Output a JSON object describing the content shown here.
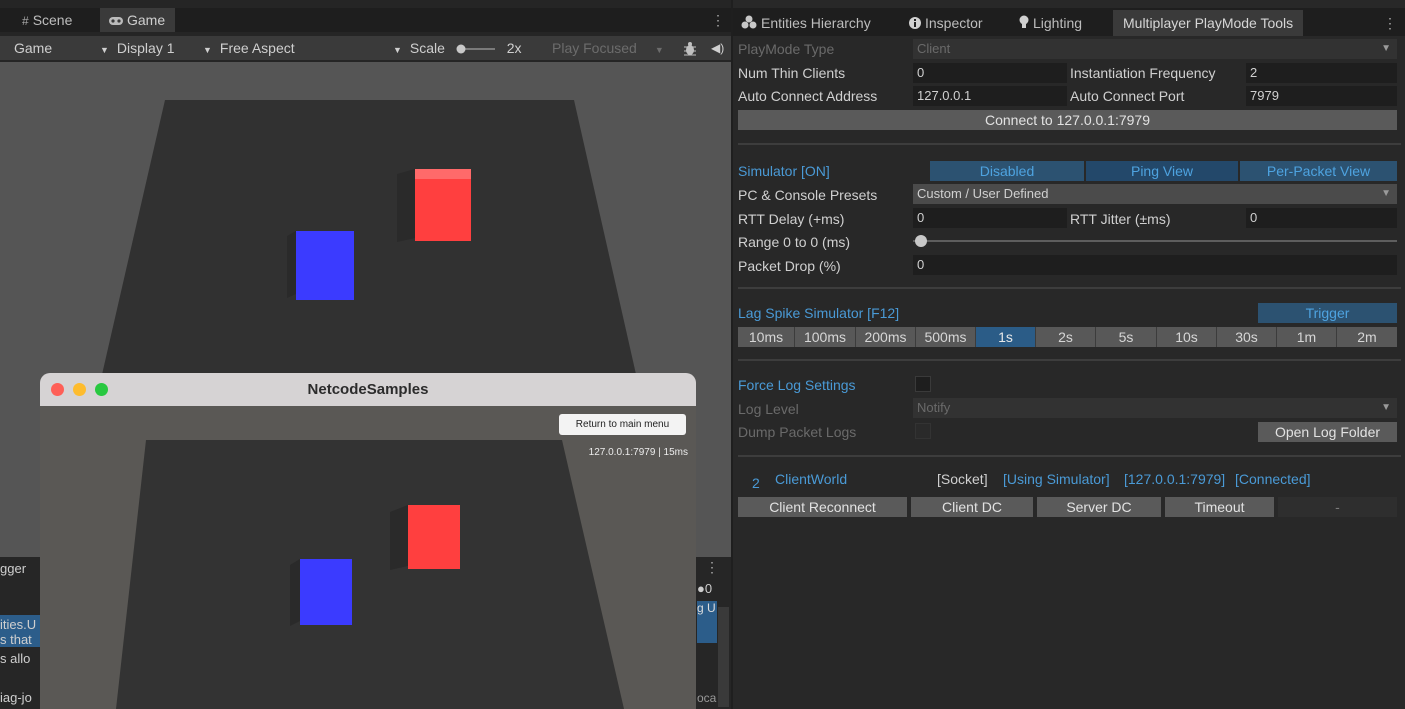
{
  "left": {
    "tabs": [
      {
        "label": "Scene",
        "icon": "grid-icon"
      },
      {
        "label": "Game",
        "icon": "gamepad-icon"
      }
    ],
    "toolbar": {
      "mode": "Game",
      "display": "Display 1",
      "aspect": "Free Aspect",
      "scale_label": "Scale",
      "scale_value": "2x",
      "play_focused": "Play Focused"
    },
    "console": {
      "lines": [
        "gger",
        "ities.U",
        "s that",
        "s allo",
        "iag-jo"
      ],
      "count": "0",
      "right_snippets": [
        "g U",
        "oca"
      ]
    },
    "window": {
      "title": "NetcodeSamples",
      "return_button": "Return to main menu",
      "address": "127.0.0.1:7979 | 15ms"
    }
  },
  "right": {
    "tabs": [
      {
        "label": "Entities Hierarchy",
        "icon": "entities-icon"
      },
      {
        "label": "Inspector",
        "icon": "info-icon"
      },
      {
        "label": "Lighting",
        "icon": "bulb-icon"
      },
      {
        "label": "Multiplayer PlayMode Tools",
        "icon": ""
      }
    ],
    "playmode_type": {
      "label": "PlayMode Type",
      "value": "Client"
    },
    "num_thin_clients": {
      "label": "Num Thin Clients",
      "value": "0"
    },
    "instantiation_frequency": {
      "label": "Instantiation Frequency",
      "value": "2"
    },
    "auto_connect_address": {
      "label": "Auto Connect Address",
      "value": "127.0.0.1"
    },
    "auto_connect_port": {
      "label": "Auto Connect Port",
      "value": "7979"
    },
    "connect_button": "Connect to 127.0.0.1:7979",
    "simulator": {
      "label": "Simulator [ON]",
      "modes": [
        "Disabled",
        "Ping View",
        "Per-Packet View"
      ],
      "presets_label": "PC & Console Presets",
      "presets_value": "Custom / User Defined",
      "rtt_delay_label": "RTT Delay (+ms)",
      "rtt_delay_value": "0",
      "rtt_jitter_label": "RTT Jitter (±ms)",
      "rtt_jitter_value": "0",
      "range_label": "Range 0 to 0 (ms)",
      "range_fraction": 0,
      "packet_drop_label": "Packet Drop (%)",
      "packet_drop_value": "0"
    },
    "lag_spike": {
      "label": "Lag Spike Simulator [F12]",
      "trigger": "Trigger",
      "durations": [
        "10ms",
        "100ms",
        "200ms",
        "500ms",
        "1s",
        "2s",
        "5s",
        "10s",
        "30s",
        "1m",
        "2m"
      ],
      "selected": "1s"
    },
    "logs": {
      "force_label": "Force Log Settings",
      "level_label": "Log Level",
      "level_value": "Notify",
      "dump_label": "Dump Packet Logs",
      "open_folder": "Open Log Folder"
    },
    "world": {
      "index": "2",
      "name": "ClientWorld",
      "socket": "[Socket]",
      "simulator": "[Using Simulator]",
      "address": "[127.0.0.1:7979]",
      "status": "[Connected]",
      "buttons": [
        "Client Reconnect",
        "Client DC",
        "Server DC",
        "Timeout"
      ],
      "extra": "-"
    }
  }
}
